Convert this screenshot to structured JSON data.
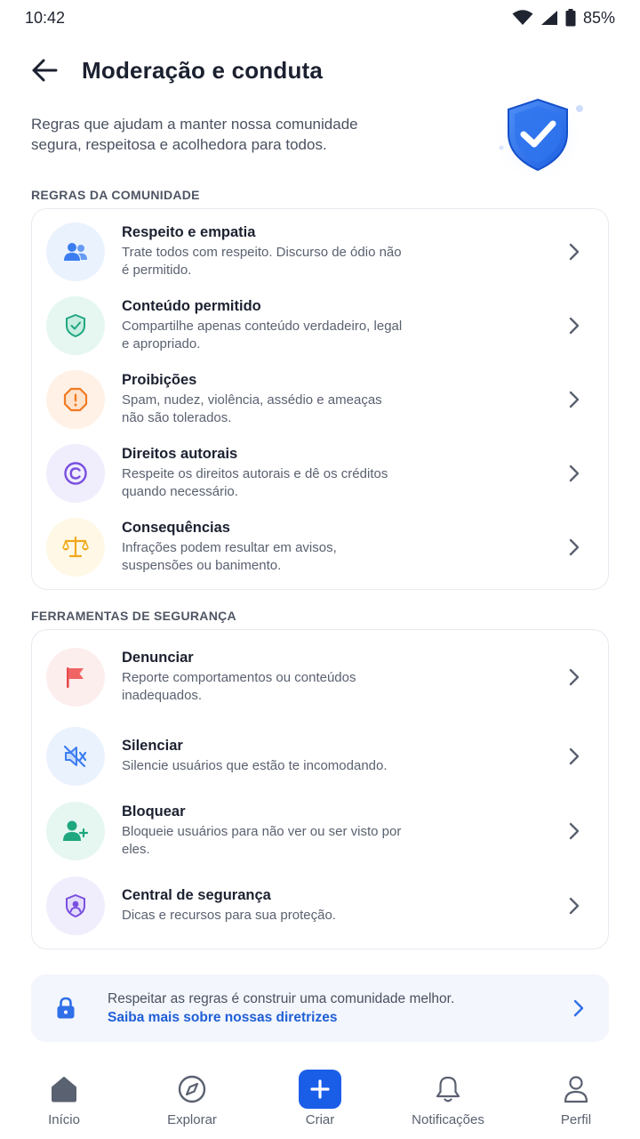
{
  "status_bar": {
    "time": "10:42",
    "battery": "85%"
  },
  "header": {
    "title": "Moderação e conduta"
  },
  "intro": {
    "text": "Regras que ajudam a manter nossa comunidade segura, respeitosa e acolhedora para todos."
  },
  "rules_section": {
    "label": "REGRAS DA COMUNIDADE",
    "items": [
      {
        "title": "Respeito e empatia",
        "desc": "Trate todos com respeito. Discurso de ódio não é permitido.",
        "icon": "people-icon"
      },
      {
        "title": "Conteúdo permitido",
        "desc": "Compartilhe apenas conteúdo verdadeiro, legal e apropriado.",
        "icon": "shield-check-icon"
      },
      {
        "title": "Proibições",
        "desc": "Spam, nudez, violência, assédio e ameaças não são tolerados.",
        "icon": "alert-octagon-icon"
      },
      {
        "title": "Direitos autorais",
        "desc": "Respeite os direitos autorais e dê os créditos quando necessário.",
        "icon": "copyright-icon"
      },
      {
        "title": "Consequências",
        "desc": "Infrações podem resultar em avisos, suspensões ou banimento.",
        "icon": "scales-icon"
      }
    ]
  },
  "tools_section": {
    "label": "FERRAMENTAS DE SEGURANÇA",
    "items": [
      {
        "title": "Denunciar",
        "desc": "Reporte comportamentos ou conteúdos inadequados.",
        "icon": "flag-icon"
      },
      {
        "title": "Silenciar",
        "desc": "Silencie usuários que estão te incomodando.",
        "icon": "mute-icon"
      },
      {
        "title": "Bloquear",
        "desc": "Bloqueie usuários para não ver ou ser visto por eles.",
        "icon": "add-user-icon"
      },
      {
        "title": "Central de segurança",
        "desc": "Dicas e recursos para sua proteção.",
        "icon": "shield-user-icon"
      }
    ]
  },
  "banner": {
    "text": "Respeitar as regras é construir uma comunidade melhor.",
    "link": "Saiba mais sobre nossas diretrizes"
  },
  "bottom_nav": {
    "items": [
      {
        "label": "Início",
        "icon": "home-icon"
      },
      {
        "label": "Explorar",
        "icon": "compass-icon"
      },
      {
        "label": "Criar",
        "icon": "plus-icon"
      },
      {
        "label": "Notificações",
        "icon": "bell-icon"
      },
      {
        "label": "Perfil",
        "icon": "user-icon"
      }
    ]
  },
  "colors": {
    "accent": "#1a5ee8",
    "link": "#1f5fd6",
    "blue_bg": "#eaf2fe",
    "green_bg": "#e6f7f2",
    "orange_bg": "#fff1e6",
    "purple_bg": "#f0edfd",
    "yellow_bg": "#fff8e6",
    "red_bg": "#fdeeee"
  }
}
